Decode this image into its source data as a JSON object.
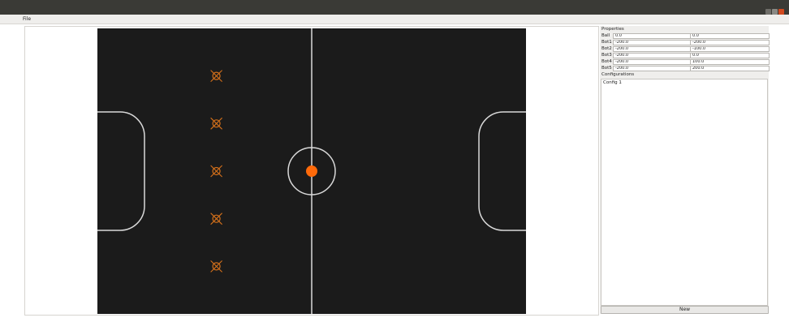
{
  "menu": {
    "file_label": "File"
  },
  "window": {
    "buttons": [
      "#6f6e69",
      "#8a8984",
      "#d2491f"
    ]
  },
  "colors": {
    "field": "#1b1b1b",
    "lines": "#d9d9d9",
    "ball": "#ff6a0a",
    "robot": "#d4701a",
    "background": "#ffffff"
  },
  "properties": {
    "title": "Properties",
    "rows": [
      {
        "name": "Ball",
        "x": "0.0",
        "y": "0.0"
      },
      {
        "name": "Bot1",
        "x": "-200.0",
        "y": "-200.0"
      },
      {
        "name": "Bot2",
        "x": "-200.0",
        "y": "-100.0"
      },
      {
        "name": "Bot3",
        "x": "-200.0",
        "y": "0.0"
      },
      {
        "name": "Bot4",
        "x": "-200.0",
        "y": "100.0"
      },
      {
        "name": "Bot5",
        "x": "-200.0",
        "y": "200.0"
      }
    ]
  },
  "configurations": {
    "title": "Configurations",
    "items": [
      "Config 1"
    ],
    "new_label": "New"
  }
}
